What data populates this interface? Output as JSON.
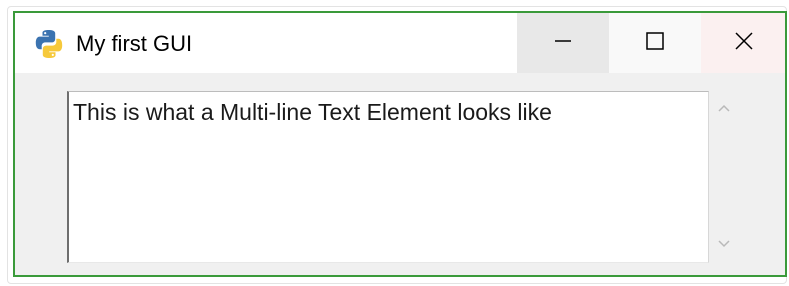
{
  "window": {
    "title": "My first GUI",
    "app_icon": "python-logo-icon",
    "controls": {
      "minimize": "minimize-icon",
      "maximize": "maximize-icon",
      "close": "close-icon"
    },
    "colors": {
      "border": "#3a9a3a",
      "background": "#f0f0f0",
      "python_blue": "#3b73b0",
      "python_yellow": "#f6c93b"
    }
  },
  "multiline": {
    "value": "This is what a Multi-line Text Element looks like"
  },
  "scrollbar": {
    "up_icon": "scroll-up-arrow-icon",
    "down_icon": "scroll-down-arrow-icon"
  }
}
